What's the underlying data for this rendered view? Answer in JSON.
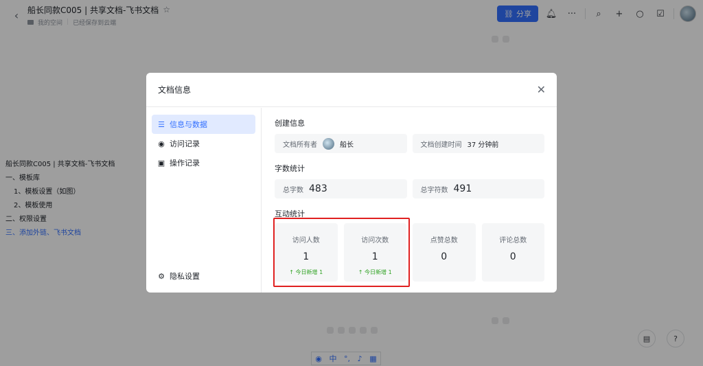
{
  "topbar": {
    "back_icon": "chevron-left-icon",
    "title": "船长同款C005 | 共享文档-飞书文档",
    "location": "我的空间",
    "save_status": "已经保存到云端",
    "share_label": "分享"
  },
  "outline": {
    "items": [
      {
        "label": "船长同款C005 | 共享文档-飞书文档",
        "level": 0,
        "active": false
      },
      {
        "label": "一、模板库",
        "level": 0,
        "active": false
      },
      {
        "label": "1、模板设置（如图）",
        "level": 1,
        "active": false
      },
      {
        "label": "2、模板使用",
        "level": 1,
        "active": false
      },
      {
        "label": "二、权限设置",
        "level": 0,
        "active": false
      },
      {
        "label": "三、添加外链、飞书文档",
        "level": 0,
        "active": true
      }
    ]
  },
  "ime": {
    "lang": "中"
  },
  "dialog": {
    "title": "文档信息",
    "nav": {
      "info": "信息与数据",
      "visits": "访问记录",
      "ops": "操作记录",
      "privacy": "隐私设置"
    },
    "create": {
      "section": "创建信息",
      "owner_label": "文档所有者",
      "owner_name": "船长",
      "created_label": "文档创建时间",
      "created_value": "37 分钟前"
    },
    "words": {
      "section": "字数统计",
      "word_label": "总字数",
      "word_value": "483",
      "char_label": "总字符数",
      "char_value": "491"
    },
    "interact": {
      "section": "互动统计",
      "stats": [
        {
          "label": "访问人数",
          "value": "1",
          "today": "↑ 今日新增 1"
        },
        {
          "label": "访问次数",
          "value": "1",
          "today": "↑ 今日新增 1"
        },
        {
          "label": "点赞总数",
          "value": "0",
          "today": ""
        },
        {
          "label": "评论总数",
          "value": "0",
          "today": ""
        }
      ]
    }
  },
  "colors": {
    "accent": "#3370ff",
    "highlight": "#e02020",
    "increase": "#2ea121"
  }
}
